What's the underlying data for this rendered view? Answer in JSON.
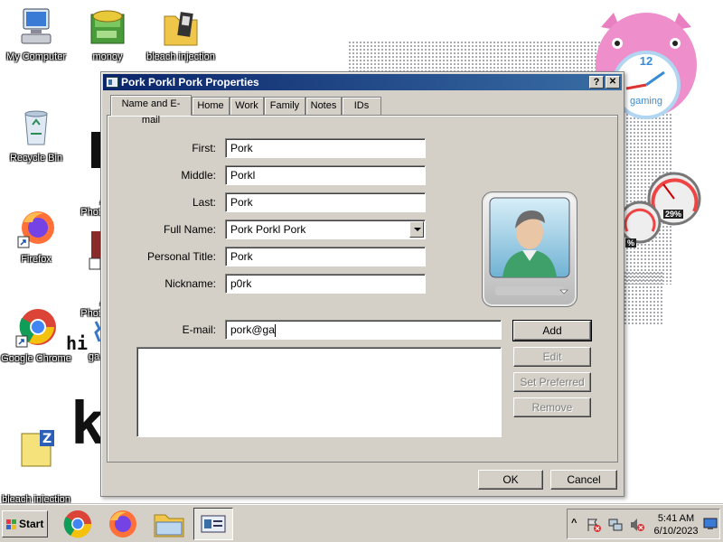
{
  "desktop": {
    "icons": [
      {
        "id": "my-computer",
        "label": "My Computer"
      },
      {
        "id": "monoy",
        "label": "monoy"
      },
      {
        "id": "bleach-folder",
        "label": "bleach injection"
      },
      {
        "id": "recycle-bin",
        "label": "Recycle Bin"
      },
      {
        "id": "photo-1",
        "label": "A\nPhoto"
      },
      {
        "id": "firefox",
        "label": "Firefox"
      },
      {
        "id": "photo-2",
        "label": "A\nPhoto"
      },
      {
        "id": "chrome",
        "label": "Google Chrome"
      },
      {
        "id": "ga",
        "label": "ga"
      },
      {
        "id": "bleach-sim",
        "label": "bleach injection\nsimulator 1.1"
      }
    ],
    "wallpaper_text": "hi",
    "clock_gadget_label": "gaming",
    "clock_gadget_hour": "12",
    "cpu_gadget_value": "29%",
    "cpu_gadget_value2": "%"
  },
  "dialog": {
    "title": "Pork Porkl Pork Properties",
    "help_label": "?",
    "close_label": "✕",
    "tabs": [
      "Name and E-mail",
      "Home",
      "Work",
      "Family",
      "Notes",
      "IDs"
    ],
    "active_tab": "Name and E-mail",
    "fields": {
      "first": {
        "label": "First:",
        "value": "Pork"
      },
      "middle": {
        "label": "Middle:",
        "value": "Porkl"
      },
      "last": {
        "label": "Last:",
        "value": "Pork"
      },
      "full_name": {
        "label": "Full Name:",
        "value": "Pork Porkl Pork"
      },
      "personal_title": {
        "label": "Personal Title:",
        "value": "Pork"
      },
      "nickname": {
        "label": "Nickname:",
        "value": "p0rk"
      },
      "email": {
        "label": "E-mail:",
        "value": "pork@ga"
      }
    },
    "buttons": {
      "add": "Add",
      "edit": "Edit",
      "set_preferred": "Set Preferred",
      "remove": "Remove",
      "ok": "OK",
      "cancel": "Cancel"
    }
  },
  "taskbar": {
    "start_label": "Start",
    "time": "5:41 AM",
    "date": "6/10/2023",
    "show_hidden": "^"
  },
  "colors": {
    "title_bar_start": "#0a246a",
    "title_bar_end": "#3a6ea5",
    "dialog_face": "#d4d0c8"
  }
}
